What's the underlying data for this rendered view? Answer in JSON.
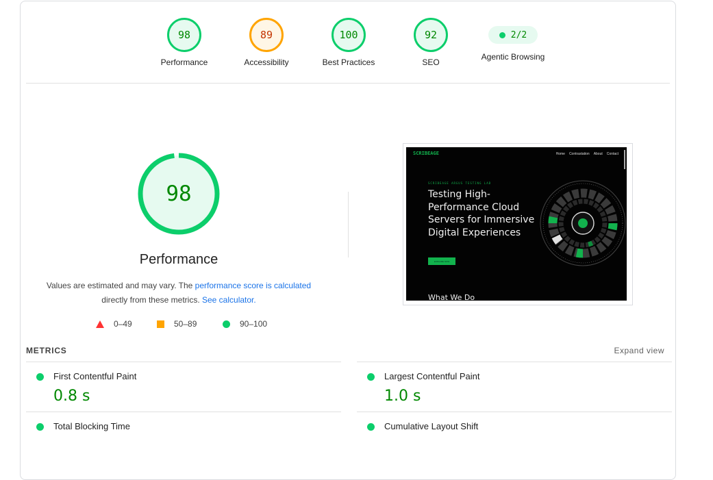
{
  "summary": {
    "gauges": [
      {
        "score": "98",
        "label": "Performance",
        "status": "pass"
      },
      {
        "score": "89",
        "label": "Accessibility",
        "status": "average"
      },
      {
        "score": "100",
        "label": "Best Practices",
        "status": "pass"
      },
      {
        "score": "92",
        "label": "SEO",
        "status": "pass"
      }
    ],
    "agentic": {
      "value": "2/2",
      "label": "Agentic Browsing"
    }
  },
  "performance": {
    "score": "98",
    "score_fraction": 0.98,
    "title": "Performance",
    "desc_prefix": "Values are estimated and may vary. The ",
    "desc_link1": "performance score is calculated",
    "desc_middle": "directly from these metrics.",
    "desc_link2": "See calculator."
  },
  "legend": [
    {
      "range": "0–49",
      "icon": "red-triangle-icon"
    },
    {
      "range": "50–89",
      "icon": "orange-square-icon"
    },
    {
      "range": "90–100",
      "icon": "green-circle-icon"
    }
  ],
  "screenshot": {
    "logo": "SCRIBEAGE",
    "nav": [
      "Home",
      "Contrastation",
      "About",
      "Contact"
    ],
    "tag": "SCRIBEAGE ARGUS TESTING LAB",
    "heading": "Testing High-Performance Cloud Servers for Immersive Digital Experiences",
    "button": "EXPLORE NOW",
    "subheading": "What We Do"
  },
  "metrics": {
    "header": "METRICS",
    "expand": "Expand view",
    "items": [
      {
        "name": "First Contentful Paint",
        "value": "0.8 s"
      },
      {
        "name": "Largest Contentful Paint",
        "value": "1.0 s"
      },
      {
        "name": "Total Blocking Time",
        "value": ""
      },
      {
        "name": "Cumulative Layout Shift",
        "value": ""
      }
    ]
  },
  "colors": {
    "pass": "#0cce6b",
    "average": "#ffa400",
    "fail": "#ff3333",
    "pass_text": "#008800",
    "link": "#1a73e8"
  }
}
